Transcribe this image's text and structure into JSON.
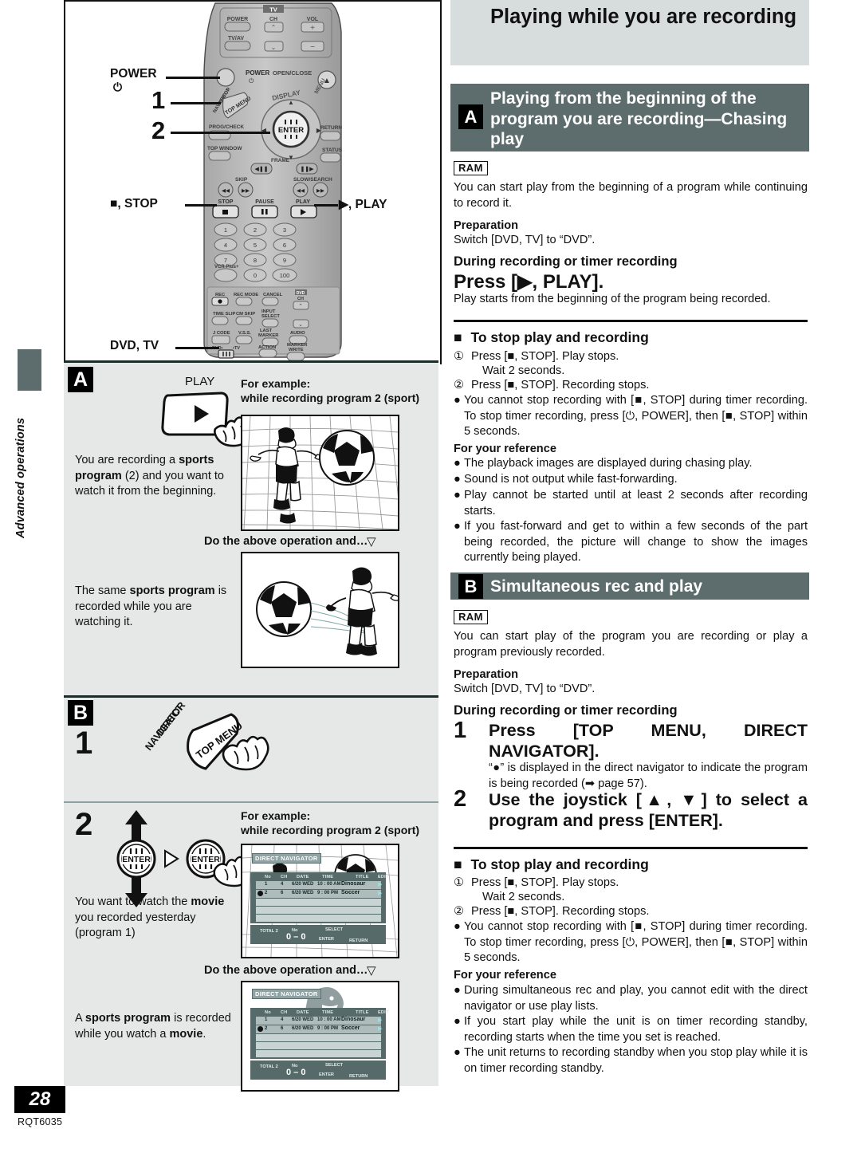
{
  "page": {
    "number": "28",
    "doc_code": "RQT6035",
    "chapter_tab": "Advanced operations"
  },
  "right": {
    "title": "Playing while you are recording",
    "section_a": {
      "tag": "A",
      "title": "Playing from the beginning of the program you are recording—Chasing play",
      "badge": "RAM",
      "intro": "You can start play from the beginning of a program while continuing to record it.",
      "prep_label": "Preparation",
      "prep_text": "Switch [DVD, TV] to “DVD”.",
      "during_label": "During recording or timer recording",
      "instruction": "Press [▶, PLAY].",
      "instruction_note": "Play starts from the beginning of the program being recorded.",
      "stop_heading": "To stop play and recording",
      "stop_steps": [
        "Press [■, STOP]. Play stops.",
        "Wait 2 seconds.",
        "Press [■, STOP]. Recording stops."
      ],
      "stop_bullet": "You cannot stop recording with [■, STOP] during timer recording. To stop timer recording, press [⏻, POWER], then [■, STOP] within 5 seconds.",
      "ref_label": "For your reference",
      "ref_bullets": [
        "The playback images are displayed during chasing play.",
        "Sound is not output while fast-forwarding.",
        "Play cannot be started until at least 2 seconds after recording starts.",
        "If you fast-forward and get to within a few seconds of the part being recorded, the picture will change to show the images currently being played."
      ]
    },
    "section_b": {
      "tag": "B",
      "title": "Simultaneous rec and play",
      "badge": "RAM",
      "intro": "You can start play of the program you are recording or play a program previously recorded.",
      "prep_label": "Preparation",
      "prep_text": "Switch [DVD, TV] to “DVD”.",
      "during_label": "During recording or timer recording",
      "step1_num": "1",
      "step1": "Press [TOP MENU, DIRECT NAVIGATOR].",
      "step1_note": "“●” is displayed in the direct navigator to indicate the program is being recorded (➡ page 57).",
      "step2_num": "2",
      "step2": "Use the joystick [▲, ▼] to select a program and press [ENTER].",
      "stop_heading": "To stop play and recording",
      "stop_steps": [
        "Press [■, STOP]. Play stops.",
        "Wait 2 seconds.",
        "Press [■, STOP]. Recording stops."
      ],
      "stop_bullet": "You cannot stop recording with [■, STOP] during timer recording. To stop timer recording, press [⏻, POWER], then [■, STOP] within 5 seconds.",
      "ref_label": "For your reference",
      "ref_bullets": [
        "During simultaneous rec and play, you cannot edit with the direct navigator or use play lists.",
        "If you start play while the unit is on timer recording standby, recording starts when the time you set is reached.",
        "The unit returns to recording standby when you stop play while it is on timer recording standby."
      ]
    }
  },
  "left": {
    "remote_labels": {
      "power": "POWER",
      "power_symbol": "⏻",
      "step1": "1",
      "step2": "2",
      "stop": "■, STOP",
      "play": "▶, PLAY",
      "dvd_tv": "DVD, TV"
    },
    "remote_keys": {
      "tv": "TV",
      "tv_power": "POWER",
      "tv_ch": "CH",
      "tv_vol": "VOL",
      "tv_av": "TV/AV",
      "power": "POWER",
      "open_close": "OPEN/CLOSE",
      "direct_navigator": "DIRECT NAVIGATOR",
      "top_menu": "TOP MENU",
      "display": "DISPLAY",
      "menu": "MENU",
      "prog_check": "PROG/CHECK",
      "top_window": "TOP WINDOW",
      "enter": "ENTER",
      "return": "RETURN",
      "status": "STATUS",
      "frame": "FRAME",
      "skip": "SKIP",
      "slow_search": "SLOW/SEARCH",
      "stop": "STOP",
      "pause": "PAUSE",
      "play": "PLAY",
      "vcr_plus": "VCR Plus+",
      "rec": "REC",
      "rec_mode": "REC MODE",
      "cancel": "CANCEL",
      "ch": "CH",
      "time_slip": "TIME SLIP",
      "cm_skip": "CM SKIP",
      "input_select": "INPUT SELECT",
      "jcode": "J CODE",
      "vss": "V.S.S.",
      "last_marker": "LAST MARKER",
      "audio": "AUDIO",
      "action": "ACTION",
      "marker_write": "MARKER WRITE",
      "dvd": "DVD",
      "tv2": "TV",
      "numbers": [
        "1",
        "2",
        "3",
        "4",
        "5",
        "6",
        "7",
        "8",
        "9",
        "0",
        "100"
      ]
    },
    "panel_a": {
      "tag": "A",
      "play_label": "PLAY",
      "text": "You are recording a sports program (2) and you want to watch it from the beginning.",
      "example_label": "For example:",
      "example_sub": "while recording program 2 (sport)",
      "do_above": "Do the above operation and…",
      "text2": "The same sports program is recorded while you are watching it."
    },
    "panel_b": {
      "tag": "B",
      "step1_num": "1",
      "button_line1": "DIRECT",
      "button_line2": "NAVIGATOR",
      "button_line3": "TOP MENU",
      "step2_num": "2",
      "enter_label": "ENTER",
      "example_label": "For example:",
      "example_sub": "while recording program 2 (sport)",
      "text": "You want to watch the movie you recorded yesterday (program 1)",
      "do_above": "Do the above operation and…",
      "text2": "A sports program is recorded while you watch a movie."
    },
    "direct_navigator": {
      "title": "DIRECT NAVIGATOR",
      "columns": [
        "No",
        "CH",
        "DATE",
        "TIME",
        "TITLE",
        "EDIT"
      ],
      "rows": [
        {
          "no": "1",
          "ch": "4",
          "date": "6/20 WED",
          "time": "10 : 00 AM",
          "title": "Dinosaur",
          "recording": false
        },
        {
          "no": "2",
          "ch": "6",
          "date": "6/20 WED",
          "time": "9 : 00 PM",
          "title": "Soccer",
          "recording": true
        }
      ],
      "total": "TOTAL 2",
      "no_label": "No",
      "no_value": "0 – 0",
      "select": "SELECT",
      "enter": "ENTER",
      "return": "RETURN"
    }
  },
  "colors": {
    "panel_gray": "#e6e7e7",
    "title_bar": "#d7dddd",
    "section_bar": "#5d6c6c",
    "tag_black": "#000000"
  }
}
